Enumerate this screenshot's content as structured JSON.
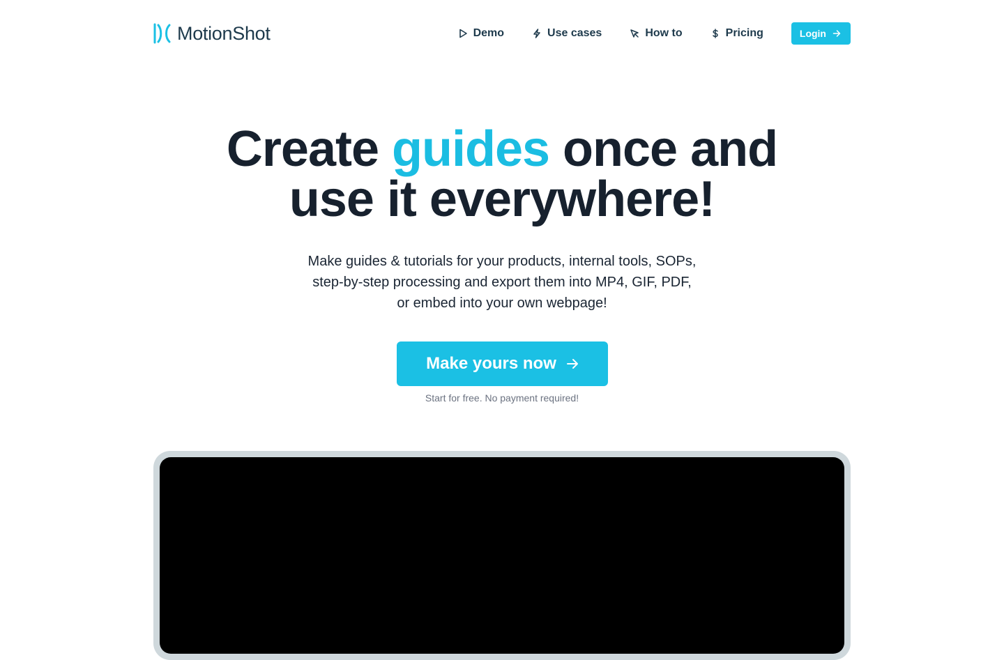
{
  "brand": {
    "name": "MotionShot",
    "accent_color": "#1bc0e4",
    "text_color": "#1e3a4c"
  },
  "nav": {
    "items": [
      {
        "label": "Demo",
        "icon": "play-icon"
      },
      {
        "label": "Use cases",
        "icon": "lightning-icon"
      },
      {
        "label": "How to",
        "icon": "cursor-click-icon"
      },
      {
        "label": "Pricing",
        "icon": "dollar-icon"
      }
    ],
    "login_label": "Login"
  },
  "hero": {
    "title_before": "Create ",
    "title_accent": "guides",
    "title_after": " once and",
    "title_line2": "use it everywhere!",
    "subtitle_lines": [
      "Make guides & tutorials for your products, internal tools, SOPs,",
      "step-by-step processing and export them into MP4, GIF, PDF,",
      "or embed into your own webpage!"
    ],
    "cta_label": "Make yours now",
    "cta_note": "Start for free. No payment required!"
  },
  "video": {
    "screen_color": "#000000",
    "frame_color": "#cfd8dc"
  }
}
